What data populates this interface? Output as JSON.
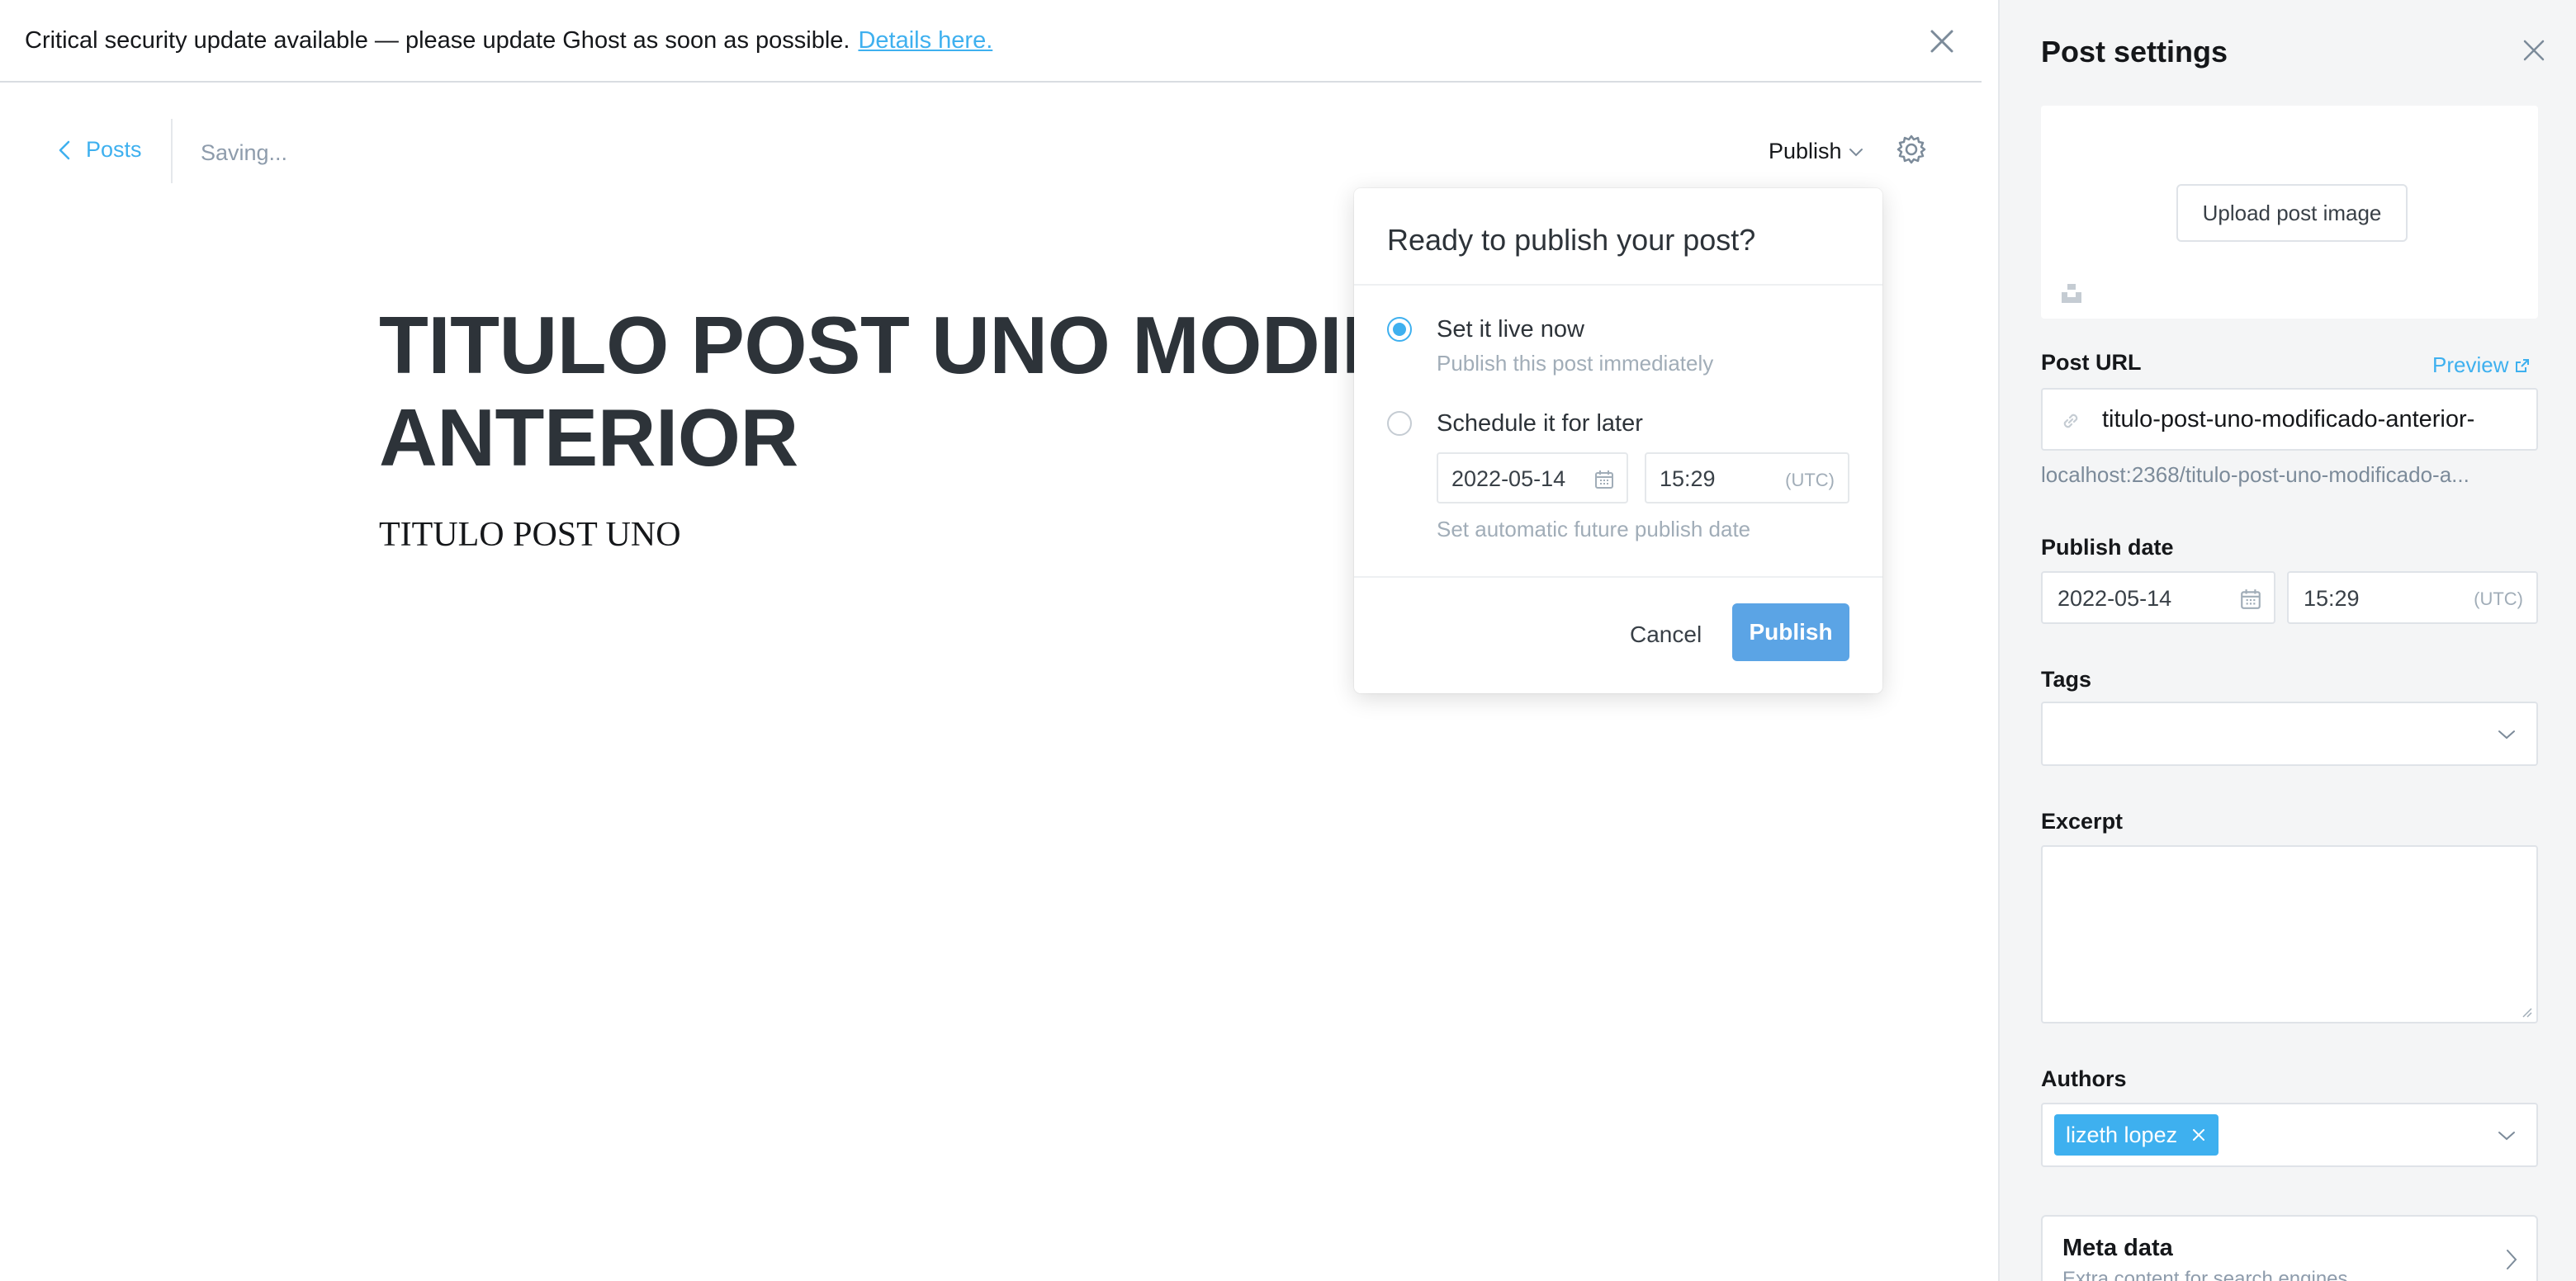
{
  "banner": {
    "message": "Critical security update available — please update Ghost as soon as possible.",
    "link_text": "Details here."
  },
  "toolbar": {
    "back_label": "Posts",
    "status": "Saving...",
    "publish_label": "Publish"
  },
  "post": {
    "title": "TITULO POST UNO MODIFICADO ANTERIOR",
    "body": "TITULO POST UNO"
  },
  "publish_popover": {
    "title": "Ready to publish your post?",
    "option_now_label": "Set it live now",
    "option_now_desc": "Publish this post immediately",
    "option_later_label": "Schedule it for later",
    "date": "2022-05-14",
    "time": "15:29",
    "timezone": "(UTC)",
    "schedule_hint": "Set automatic future publish date",
    "cancel_label": "Cancel",
    "publish_label": "Publish",
    "selected_option": "now"
  },
  "settings": {
    "title": "Post settings",
    "upload_label": "Upload post image",
    "url_label": "Post URL",
    "preview_label": "Preview",
    "url_value": "titulo-post-uno-modificado-anterior-",
    "url_full": "localhost:2368/titulo-post-uno-modificado-a...",
    "publish_date_label": "Publish date",
    "publish_date": "2022-05-14",
    "publish_time": "15:29",
    "timezone": "(UTC)",
    "tags_label": "Tags",
    "excerpt_label": "Excerpt",
    "authors_label": "Authors",
    "author_name": "lizeth lopez",
    "meta_title": "Meta data",
    "meta_sub": "Extra content for search engines"
  },
  "colors": {
    "accent": "#3eb0ef",
    "publish_button": "#5ba4e5",
    "panel_bg": "#f4f5f6"
  }
}
